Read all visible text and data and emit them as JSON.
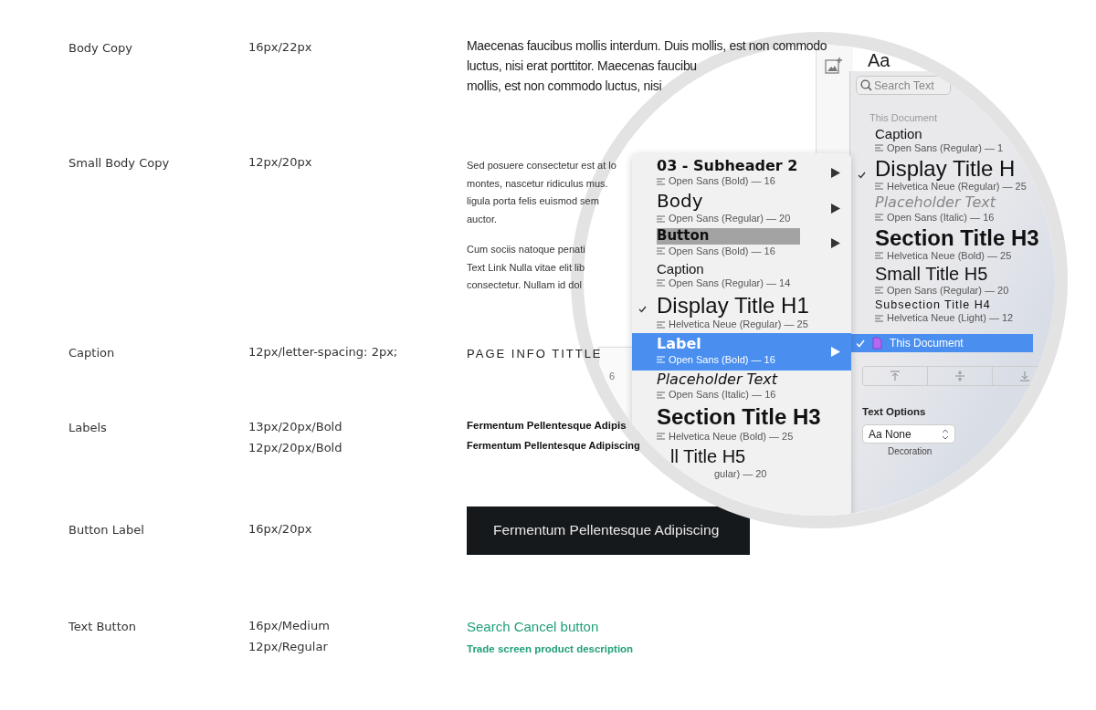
{
  "spec_rows": [
    {
      "name": "Body Copy",
      "kind": "body",
      "specs": [
        "16px/22px"
      ],
      "paragraphs": [
        [
          "Maecenas faucibus mollis interdum. Duis mollis, est non commodo",
          "luctus, nisi erat porttitor. Maecenas faucibu",
          "mollis, est non commodo luctus, nisi"
        ]
      ]
    },
    {
      "name": "Small Body Copy",
      "kind": "small",
      "specs": [
        "12px/20px"
      ],
      "paragraphs": [
        [
          "Sed posuere consectetur est at lo",
          "montes, nascetur ridiculus mus.",
          "ligula porta felis euismod sem",
          "auctor."
        ],
        [
          "Cum sociis natoque penati",
          "Text Link Nulla vitae elit lib",
          "consectetur. Nullam id dol"
        ]
      ]
    },
    {
      "name": "Caption",
      "kind": "caption",
      "specs": [
        "12px/letter-spacing: 2px;"
      ],
      "paragraphs": [
        [
          "PAGE INFO TITTLE"
        ]
      ]
    },
    {
      "name": "Labels",
      "kind": "labels",
      "specs": [
        "13px/20px/Bold",
        "12px/20px/Bold"
      ],
      "paragraphs": [
        [
          "Fermentum Pellentesque Adipis"
        ],
        [
          "Fermentum Pellentesque Adipiscing"
        ]
      ]
    },
    {
      "name": "Button Label",
      "kind": "button",
      "specs": [
        "16px/20px"
      ],
      "paragraphs": [
        [
          "Fermentum Pellentesque Adipiscing"
        ]
      ]
    },
    {
      "name": "Text Button",
      "kind": "text-button",
      "specs": [
        "16px/Medium",
        "12px/Regular"
      ],
      "paragraphs": [
        [
          "Search Cancel button"
        ],
        [
          "Trade screen product description"
        ]
      ]
    }
  ],
  "magnifier": {
    "back_panel": {
      "text": "6"
    },
    "toolbar": {
      "heading": "Aa"
    },
    "search": {
      "placeholder": "Search Text"
    },
    "section_label": "This Document",
    "styles": [
      {
        "name": "Caption",
        "font": "Open Sans (Regular) — 1",
        "kind": "caption",
        "checked": false
      },
      {
        "name": "Display Title H",
        "font": "Helvetica Neue (Regular) — 25",
        "kind": "display",
        "checked": true
      },
      {
        "name": "Placeholder Text",
        "font": "Open Sans (Italic) — 16",
        "kind": "italic",
        "checked": false
      },
      {
        "name": "Section Title H3",
        "font": "Helvetica Neue (Bold) — 25",
        "kind": "section",
        "checked": false
      },
      {
        "name": "Small Title H5",
        "font": "Open Sans (Regular) — 20",
        "kind": "small",
        "checked": false
      },
      {
        "name": "Subsection Title H4",
        "font": "Helvetica Neue (Light) — 12",
        "kind": "spaced",
        "checked": false
      }
    ],
    "library": {
      "label": "This Document",
      "selected": true
    },
    "text_options": {
      "title": "Text Options",
      "decoration": "Aa None",
      "decoration_label": "Decoration"
    },
    "menu": [
      {
        "name": "03 - Subheader 2",
        "font": "Open Sans (Bold) — 16",
        "kind": "sub",
        "checked": false,
        "selected": false,
        "submenu": true
      },
      {
        "name": "Body",
        "font": "Open Sans (Regular) — 20",
        "kind": "body",
        "checked": false,
        "selected": false,
        "submenu": true
      },
      {
        "name": "Button",
        "font": "Open Sans (Bold) — 16",
        "kind": "boxed",
        "checked": false,
        "selected": false,
        "submenu": true
      },
      {
        "name": "Caption",
        "font": "Open Sans (Regular) — 14",
        "kind": "caption",
        "checked": false,
        "selected": false,
        "submenu": false
      },
      {
        "name": "Display Title H1",
        "font": "Helvetica Neue (Regular) — 25",
        "kind": "display",
        "checked": true,
        "selected": false,
        "submenu": false
      },
      {
        "name": "Label",
        "font": "Open Sans (Bold) — 16",
        "kind": "label",
        "checked": false,
        "selected": true,
        "submenu": true
      },
      {
        "name": "Placeholder Text",
        "font": "Open Sans (Italic) — 16",
        "kind": "italic",
        "checked": false,
        "selected": false,
        "submenu": false
      },
      {
        "name": "Section Title H3",
        "font": "Helvetica Neue (Bold) — 25",
        "kind": "section",
        "checked": false,
        "selected": false,
        "submenu": false
      },
      {
        "name": "ll Title H5",
        "font": "gular) — 20",
        "kind": "small-cut",
        "checked": false,
        "selected": false,
        "submenu": false
      }
    ]
  }
}
